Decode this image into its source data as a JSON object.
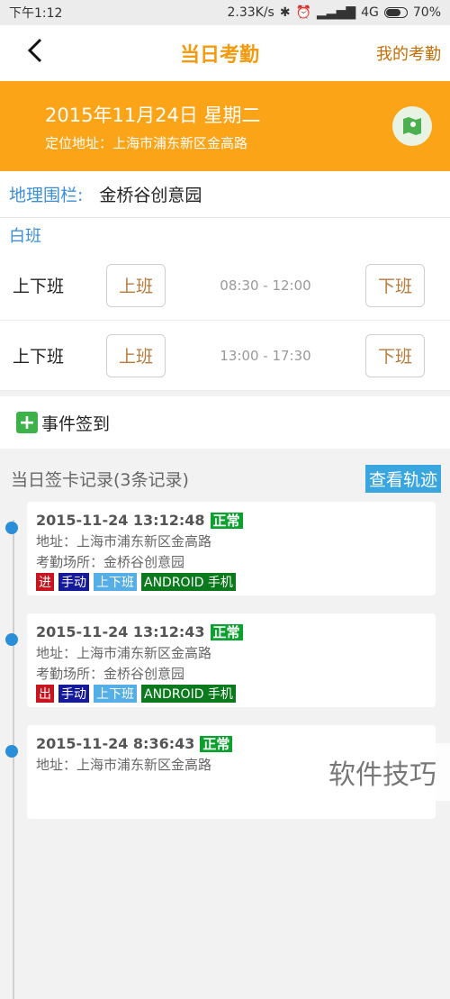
{
  "status": {
    "time": "下午1:12",
    "speed": "2.33K/s",
    "network": "4G",
    "battery": "70%"
  },
  "nav": {
    "title": "当日考勤",
    "right": "我的考勤"
  },
  "banner": {
    "date": "2015年11月24日 星期二",
    "location": "定位地址：上海市浦东新区金高路"
  },
  "fence": {
    "label": "地理围栏:",
    "value": "金桥谷创意园"
  },
  "shift": {
    "title": "白班",
    "rows": [
      {
        "name": "上下班",
        "start_label": "上班",
        "time": "08:30 - 12:00",
        "end_label": "下班"
      },
      {
        "name": "上下班",
        "start_label": "上班",
        "time": "13:00 - 17:30",
        "end_label": "下班"
      }
    ]
  },
  "event": {
    "icon": "plus-icon",
    "label": "事件签到"
  },
  "records": {
    "title": "当日签卡记录(3条记录)",
    "track_label": "查看轨迹",
    "items": [
      {
        "time": "2015-11-24 13:12:48",
        "status": "正常",
        "address": "地址：上海市浦东新区金高路",
        "place": "考勤场所：金桥谷创意园",
        "dir": "进",
        "mode": "手动",
        "type": "上下班",
        "device": "ANDROID 手机"
      },
      {
        "time": "2015-11-24 13:12:43",
        "status": "正常",
        "address": "地址：上海市浦东新区金高路",
        "place": "考勤场所：金桥谷创意园",
        "dir": "出",
        "mode": "手动",
        "type": "上下班",
        "device": "ANDROID 手机"
      },
      {
        "time": "2015-11-24 8:36:43",
        "status": "正常",
        "address": "地址：上海市浦东新区金高路",
        "place": "",
        "dir": "",
        "mode": "",
        "type": "",
        "device": ""
      }
    ]
  },
  "watermark": "软件技巧",
  "colors": {
    "accent": "#fba418",
    "title": "#f39a0e",
    "link": "#3c8fd8",
    "ok": "#0aa12f"
  }
}
